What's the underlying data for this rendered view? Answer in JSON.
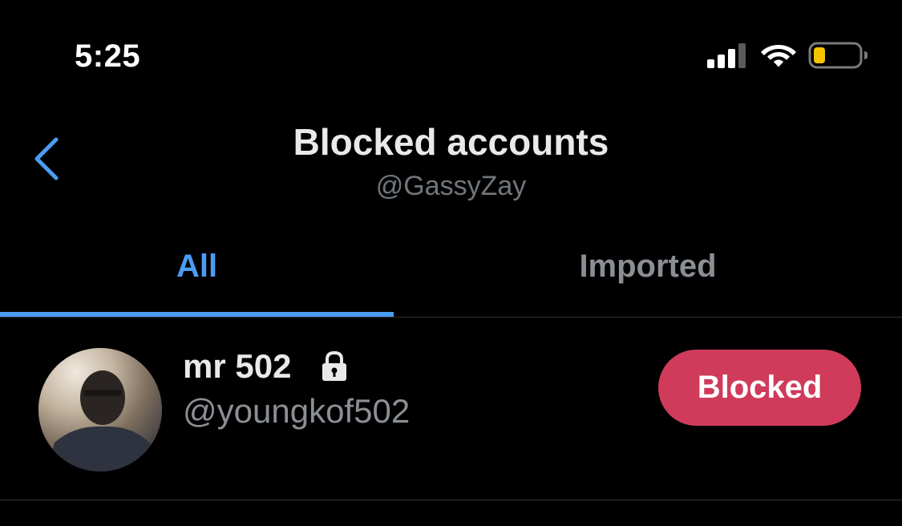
{
  "status_bar": {
    "time": "5:25",
    "icons": [
      "cellular-signal-icon",
      "wifi-icon",
      "battery-icon"
    ],
    "battery_color": "#f5c400"
  },
  "header": {
    "title": "Blocked accounts",
    "subtitle": "@GassyZay",
    "back_icon": "chevron-left-icon"
  },
  "tabs": [
    {
      "label": "All",
      "selected": true
    },
    {
      "label": "Imported",
      "selected": false
    }
  ],
  "accounts": [
    {
      "name": "mr 502",
      "protected_icon": "lock-icon",
      "handle": "@youngkof502",
      "button_label": "Blocked"
    }
  ],
  "colors": {
    "background": "#000000",
    "accent": "#4a9df0",
    "blocked_button": "#d03a5b",
    "secondary_text": "#8b8f94"
  }
}
